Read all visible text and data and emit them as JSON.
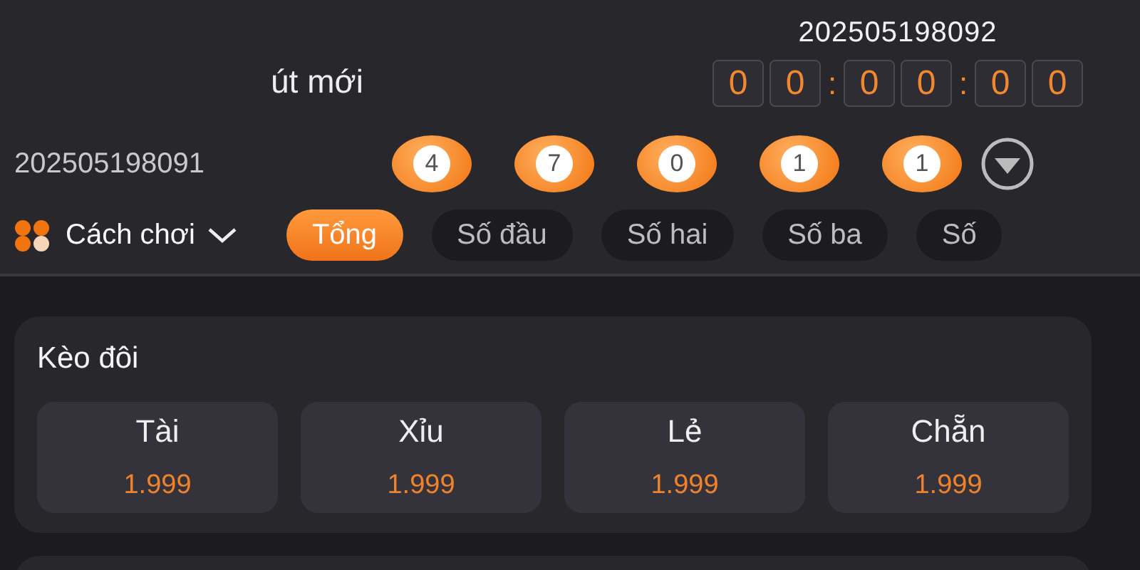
{
  "header": {
    "title": "út mới",
    "next_period": "202505198092",
    "countdown": [
      {
        "kind": "digit",
        "text": "0"
      },
      {
        "kind": "digit",
        "text": "0"
      },
      {
        "kind": "separator",
        "text": ":"
      },
      {
        "kind": "digit",
        "text": "0"
      },
      {
        "kind": "digit",
        "text": "0"
      },
      {
        "kind": "separator",
        "text": ":"
      },
      {
        "kind": "digit",
        "text": "0"
      },
      {
        "kind": "digit",
        "text": "0"
      }
    ]
  },
  "last_result": {
    "period": "202505198091",
    "balls": [
      "4",
      "7",
      "0",
      "1",
      "1"
    ]
  },
  "play_menu": {
    "label": "Cách chơi"
  },
  "tabs": [
    {
      "label": "Tổng",
      "selected": true
    },
    {
      "label": "Số đầu",
      "selected": false
    },
    {
      "label": "Số hai",
      "selected": false
    },
    {
      "label": "Số ba",
      "selected": false
    },
    {
      "label": "Số",
      "selected": false
    }
  ],
  "bet_group": {
    "title": "Kèo đôi",
    "options": [
      {
        "label": "Tài",
        "odds": "1.999"
      },
      {
        "label": "Xỉu",
        "odds": "1.999"
      },
      {
        "label": "Lẻ",
        "odds": "1.999"
      },
      {
        "label": "Chẵn",
        "odds": "1.999"
      }
    ]
  }
}
